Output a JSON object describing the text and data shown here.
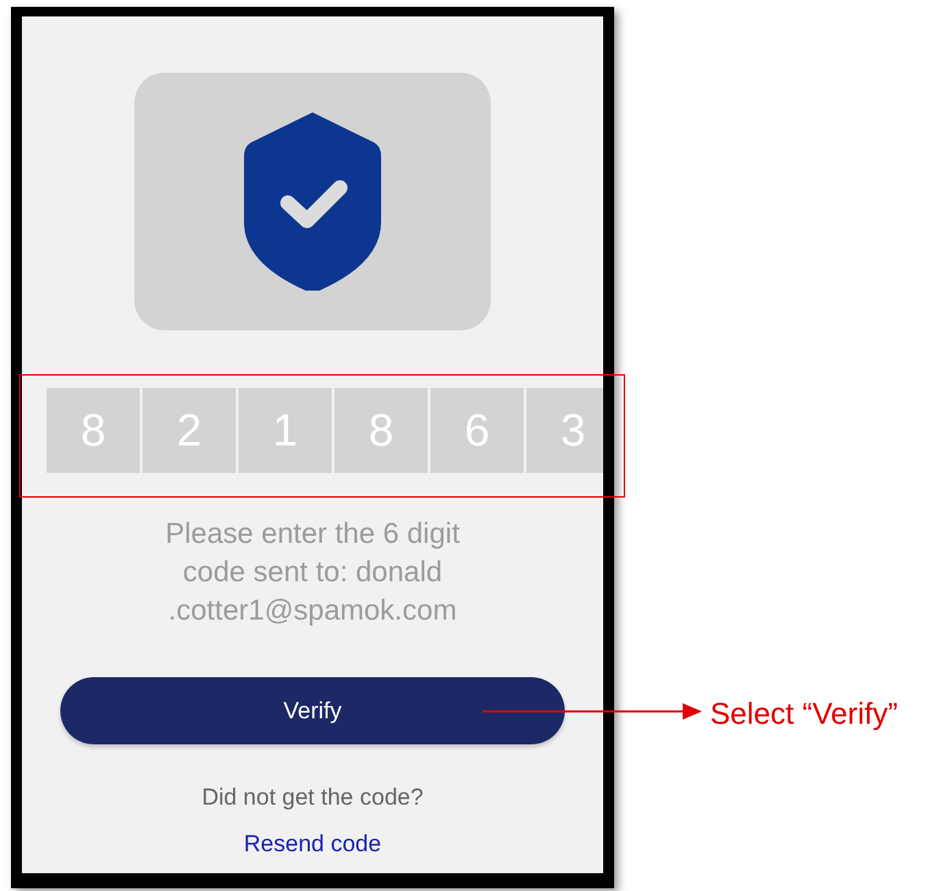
{
  "code_digits": [
    "8",
    "2",
    "1",
    "8",
    "6",
    "3"
  ],
  "message_lines": [
    "Please enter the 6 digit",
    "code sent to: donald",
    ".cotter1@spamok.com"
  ],
  "verify_button": "Verify",
  "prompt": "Did not get the code?",
  "resend_link": "Resend code",
  "annotation": {
    "label": "Select “Verify”"
  }
}
